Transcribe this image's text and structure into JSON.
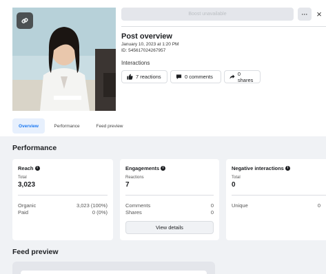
{
  "boost": {
    "label": "Boost unavailable"
  },
  "header": {
    "more_label": "···",
    "close_label": "×"
  },
  "post": {
    "title": "Post overview",
    "date": "January 10, 2023 at 1:20 PM",
    "id_text": "ID: 545617024267957",
    "interactions_label": "Interactions"
  },
  "interactions": {
    "reactions": "7 reactions",
    "comments": "0 comments",
    "shares": "0 shares"
  },
  "tabs": {
    "overview": "Overview",
    "performance": "Performance",
    "feed_preview": "Feed preview"
  },
  "performance": {
    "title": "Performance",
    "reach": {
      "title": "Reach",
      "sub": "Total",
      "value": "3,023",
      "rows": [
        {
          "label": "Organic",
          "value": "3,023 (100%)"
        },
        {
          "label": "Paid",
          "value": "0 (0%)"
        }
      ]
    },
    "engagements": {
      "title": "Engagements",
      "sub": "Reactions",
      "value": "7",
      "rows": [
        {
          "label": "Comments",
          "value": "0"
        },
        {
          "label": "Shares",
          "value": "0"
        }
      ],
      "button": "View details"
    },
    "negative": {
      "title": "Negative interactions",
      "sub": "Total",
      "value": "0",
      "rows": [
        {
          "label": "Unique",
          "value": "0"
        }
      ]
    }
  },
  "feed_preview": {
    "title": "Feed preview"
  },
  "colors": {
    "accent": "#1877f2",
    "tab_active_bg": "#e7f0fd",
    "card_bg": "#ffffff",
    "page_bg": "#f0f2f5"
  }
}
